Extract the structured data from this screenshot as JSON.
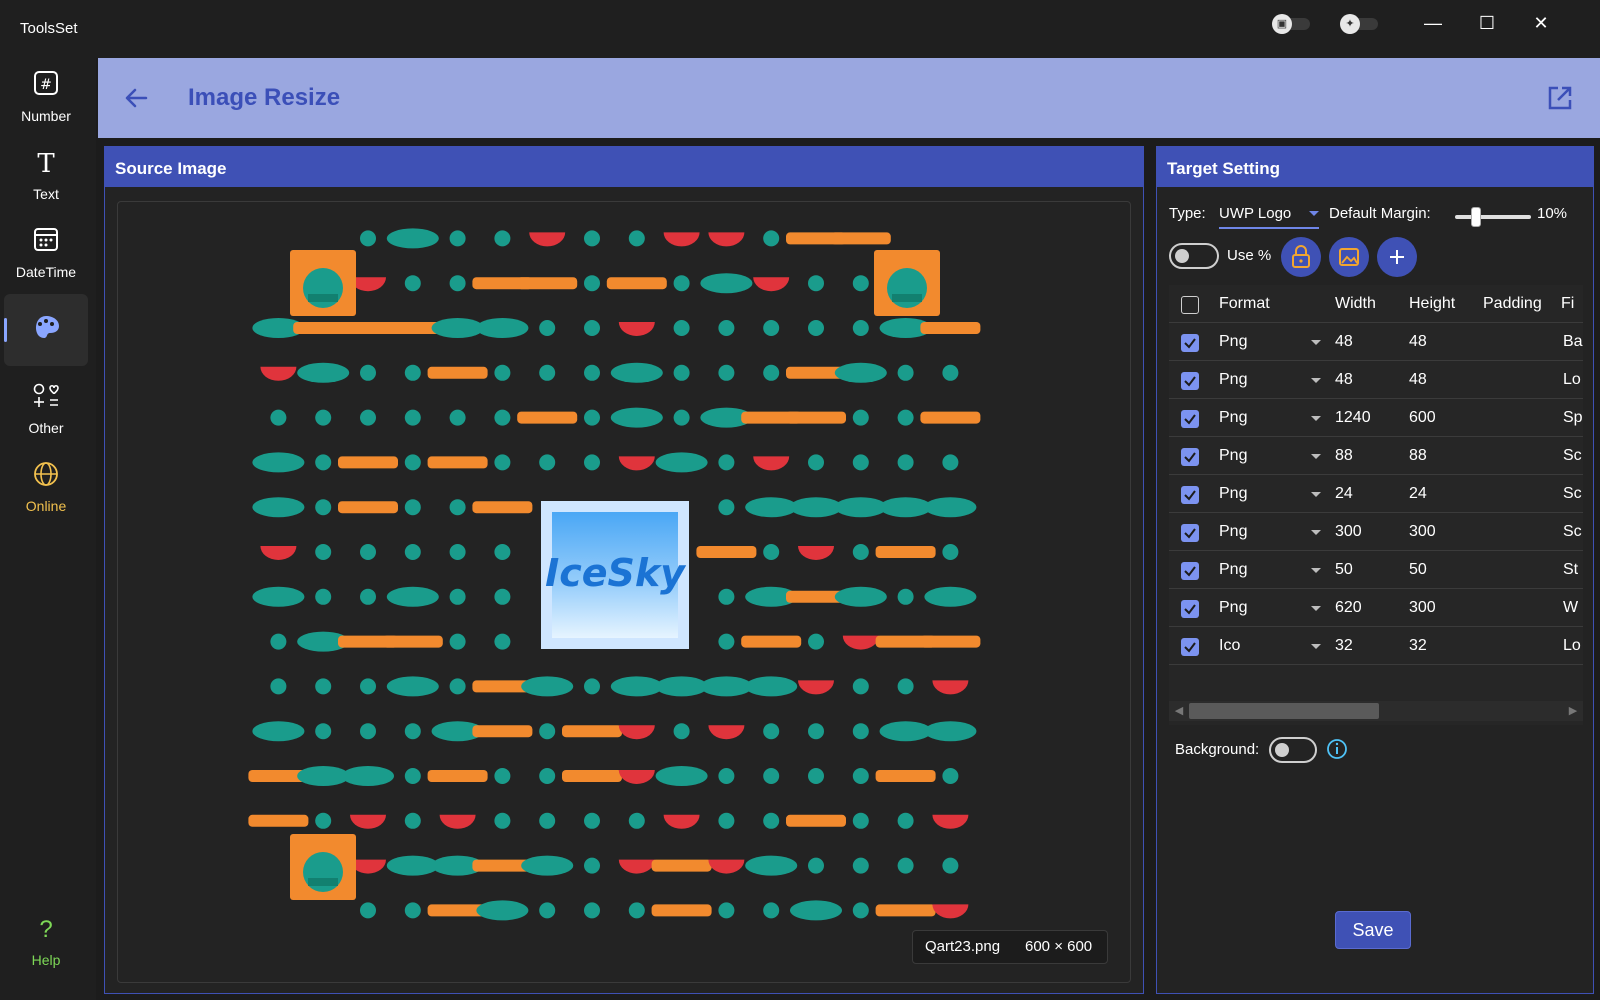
{
  "app": {
    "title": "ToolsSet"
  },
  "titlebar": {
    "minimize": "—",
    "maximize": "☐",
    "close": "✕"
  },
  "sidebar": {
    "items": [
      {
        "label": "Number",
        "icon": "hash-icon"
      },
      {
        "label": "Text",
        "icon": "text-icon"
      },
      {
        "label": "DateTime",
        "icon": "calendar-icon"
      },
      {
        "label": "",
        "icon": "palette-icon",
        "selected": true
      },
      {
        "label": "Other",
        "icon": "shapes-icon"
      },
      {
        "label": "Online",
        "icon": "globe-icon",
        "color": "#f2c14e"
      }
    ],
    "help": {
      "label": "Help",
      "glyph": "?",
      "color": "#7ed957"
    }
  },
  "header": {
    "title": "Image Resize"
  },
  "source": {
    "title": "Source Image",
    "file_name": "Qart23.png",
    "dimensions": "600 × 600",
    "logo_text": "IceSky"
  },
  "target": {
    "title": "Target Setting",
    "type_label": "Type:",
    "type_value": "UWP Logo",
    "margin_label": "Default Margin:",
    "margin_value": "10%",
    "margin_fraction": 0.1,
    "use_percent_label": "Use %",
    "use_percent_on": false,
    "columns": [
      "Format",
      "Width",
      "Height",
      "Padding",
      "Fi"
    ],
    "rows": [
      {
        "format": "Png",
        "width": "48",
        "height": "48",
        "file": "Ba",
        "checked": true
      },
      {
        "format": "Png",
        "width": "48",
        "height": "48",
        "file": "Lo",
        "checked": true
      },
      {
        "format": "Png",
        "width": "1240",
        "height": "600",
        "file": "Sp",
        "checked": true
      },
      {
        "format": "Png",
        "width": "88",
        "height": "88",
        "file": "Sc",
        "checked": true
      },
      {
        "format": "Png",
        "width": "24",
        "height": "24",
        "file": "Sc",
        "checked": true
      },
      {
        "format": "Png",
        "width": "300",
        "height": "300",
        "file": "Sc",
        "checked": true
      },
      {
        "format": "Png",
        "width": "50",
        "height": "50",
        "file": "St",
        "checked": true
      },
      {
        "format": "Png",
        "width": "620",
        "height": "300",
        "file": "W",
        "checked": true
      },
      {
        "format": "Ico",
        "width": "32",
        "height": "32",
        "file": "Lo",
        "checked": true
      }
    ],
    "background_label": "Background:",
    "background_on": false,
    "save_label": "Save"
  },
  "colors": {
    "accent": "#3f51b5",
    "header_bg": "#9aa7e0",
    "title": "#3b4fb8",
    "teal": "#1a9c8c",
    "orange": "#f28a2e",
    "red": "#e0343c"
  }
}
